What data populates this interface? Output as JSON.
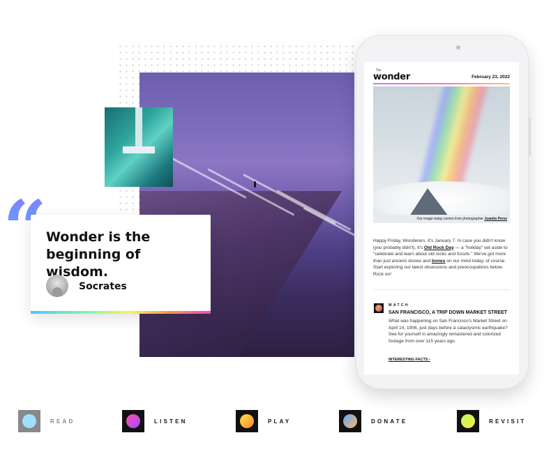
{
  "quote": {
    "text": "Wonder is the beginning of wisdom.",
    "author": "Socrates"
  },
  "newsletter": {
    "logo_small": "The",
    "logo": "wonder",
    "date": "February 23, 2022",
    "hero_caption_prefix": "Our image today comes from photographer ",
    "hero_caption_credit": "Juanito Perez",
    "intro_1": "Happy Friday, Wonderers. It's January 7. In case you didn't know (you probably didn't), it's ",
    "intro_link": "Old Rock Day",
    "intro_2": " — a \"holiday\" set aside to \"celebrate and learn about old rocks and fossils.\" We've got more than just ancient stones and ",
    "intro_bold": "bones",
    "intro_3": " on our mind today, of course. Start exploring our latest obsessions and preoccupations below. Rock on!",
    "section_label": "WATCH",
    "section_title": "SAN FRANCISCO, A TRIP DOWN MARKET STREET",
    "section_body": "What was happening on San Francisco's Market Street on April 14, 1906, just days before a cataclysmic earthquake? See for yourself in amazingly remastered and colorized footage from over 115 years ago.",
    "section_link": "INTERESTING FACTS ›"
  },
  "nav": [
    {
      "label": "READ",
      "icon": "read-icon",
      "bg": "#888888",
      "circle": "#9fe0ff",
      "label_color": "#888888"
    },
    {
      "label": "LISTEN",
      "icon": "listen-icon",
      "bg": "#111111",
      "circle": "linear-gradient(135deg,#ff4fb0,#9a4dff)",
      "label_color": "#111111"
    },
    {
      "label": "PLAY",
      "icon": "play-icon",
      "bg": "#111111",
      "circle": "linear-gradient(135deg,#ffe14d,#ff8a2a)",
      "label_color": "#111111"
    },
    {
      "label": "DONATE",
      "icon": "donate-icon",
      "bg": "#111111",
      "circle": "linear-gradient(135deg,#5fa8ff,#ffb86b)",
      "label_color": "#111111"
    },
    {
      "label": "REVISIT",
      "icon": "revisit-icon",
      "bg": "#111111",
      "circle": "linear-gradient(135deg,#b9ff5a,#ffe84d)",
      "label_color": "#111111"
    }
  ]
}
